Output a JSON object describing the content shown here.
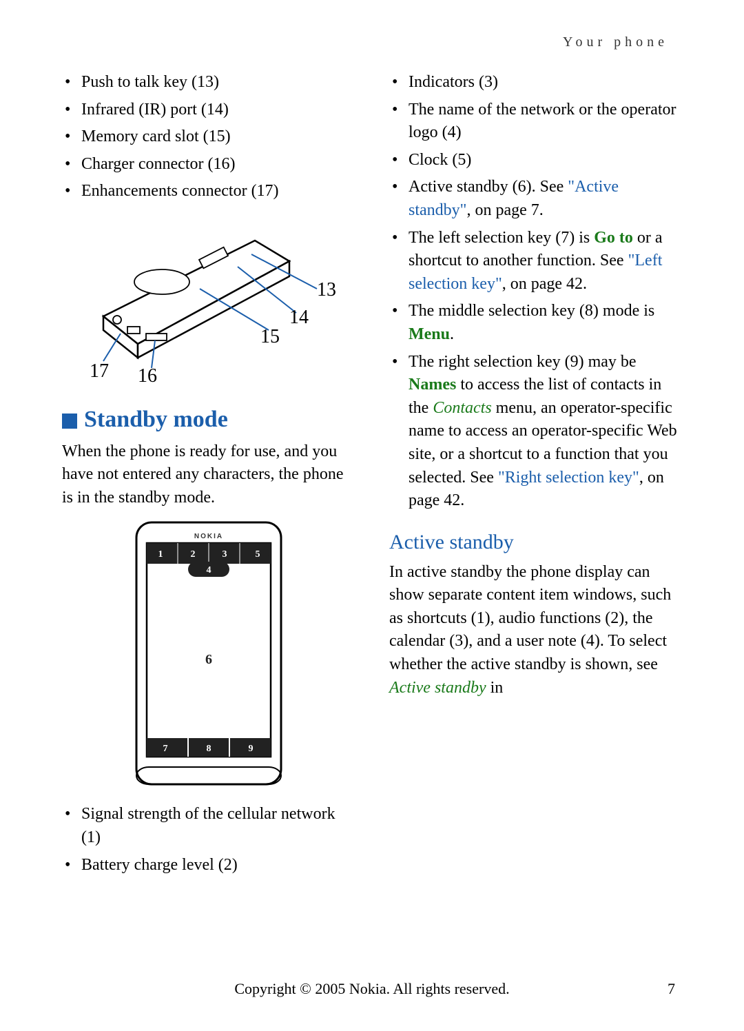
{
  "header": "Your phone",
  "left": {
    "bullets1": [
      "Push to talk key (13)",
      "Infrared (IR) port (14)",
      "Memory card slot (15)",
      "Charger connector (16)",
      "Enhancements connector (17)"
    ],
    "fig_callouts": {
      "a": "13",
      "b": "14",
      "c": "15",
      "d": "16",
      "e": "17"
    },
    "standby_heading": "Standby mode",
    "standby_para": "When the phone is ready for use, and you have not entered any characters, the phone is in the standby mode.",
    "phone_brand": "NOKIA",
    "screen_nums": {
      "n1": "1",
      "n2": "2",
      "n3": "3",
      "n4": "4",
      "n5": "5",
      "n6": "6",
      "n7": "7",
      "n8": "8",
      "n9": "9"
    },
    "bullets2_a": "Signal strength of the cellular network (1)",
    "bullets2_b": "Battery charge level (2)"
  },
  "right": {
    "r1": "Indicators (3)",
    "r2": "The name of the network or the operator logo (4)",
    "r3": "Clock (5)",
    "r4_a": "Active standby (6). See ",
    "r4_link": "\"Active standby\"",
    "r4_b": ", on page 7.",
    "r5_a": "The left selection key (7) is ",
    "r5_bold": "Go to",
    "r5_b": " or a shortcut to another function. See ",
    "r5_link": "\"Left selection key\"",
    "r5_c": ", on page 42.",
    "r6_a": "The middle selection key (8) mode is ",
    "r6_bold": "Menu",
    "r6_b": ".",
    "r7_a": "The right selection key (9) may be ",
    "r7_bold": "Names",
    "r7_b": " to access the list of contacts in the ",
    "r7_it": "Contacts",
    "r7_c": " menu, an operator-specific name to access an operator-specific Web site, or a shortcut to a function that you selected. See ",
    "r7_link": "\"Right selection key\"",
    "r7_d": ", on page 42.",
    "active_heading": "Active standby",
    "active_para_a": "In active standby the phone display can show separate content item windows, such as shortcuts (1), audio functions (2), the calendar (3), and a user note (4). To select whether the active standby is shown, see ",
    "active_it": "Active standby",
    "active_para_b": " in"
  },
  "footer": "Copyright © 2005 Nokia. All rights reserved.",
  "page_number": "7"
}
